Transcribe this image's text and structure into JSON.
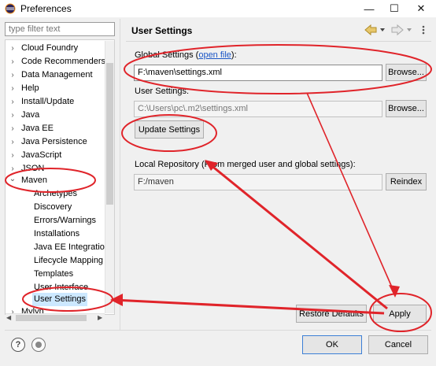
{
  "window": {
    "title": "Preferences",
    "minimize_glyph": "—",
    "maximize_glyph": "☐",
    "close_glyph": "✕",
    "icon": "eclipse-icon"
  },
  "filter": {
    "placeholder": "type filter text"
  },
  "tree": {
    "items": [
      {
        "label": "Cloud Foundry",
        "arrow": "›"
      },
      {
        "label": "Code Recommenders",
        "arrow": "›"
      },
      {
        "label": "Data Management",
        "arrow": "›"
      },
      {
        "label": "Help",
        "arrow": "›"
      },
      {
        "label": "Install/Update",
        "arrow": "›"
      },
      {
        "label": "Java",
        "arrow": "›"
      },
      {
        "label": "Java EE",
        "arrow": "›"
      },
      {
        "label": "Java Persistence",
        "arrow": "›"
      },
      {
        "label": "JavaScript",
        "arrow": "›"
      },
      {
        "label": "JSON",
        "arrow": "›"
      },
      {
        "label": "Maven",
        "arrow": "⌄"
      },
      {
        "label": "Archetypes"
      },
      {
        "label": "Discovery"
      },
      {
        "label": "Errors/Warnings"
      },
      {
        "label": "Installations"
      },
      {
        "label": "Java EE Integratio"
      },
      {
        "label": "Lifecycle Mapping"
      },
      {
        "label": "Templates"
      },
      {
        "label": "User Interface"
      },
      {
        "label": "User Settings"
      },
      {
        "label": "Mylyn",
        "arrow": "›"
      }
    ],
    "selected": "User Settings"
  },
  "page": {
    "title": "User Settings",
    "global_label": "Global Settings (",
    "global_link": "open file",
    "global_label_end": "):",
    "global_value": "F:\\maven\\settings.xml",
    "user_label": "User Settings:",
    "user_value": "C:\\Users\\pc\\.m2\\settings.xml",
    "browse1": "Browse...",
    "browse2": "Browse...",
    "update_button": "Update Settings",
    "local_repo_label": "Local Repository (From merged user and global settings):",
    "local_repo_value": "F:/maven",
    "reindex_button": "Reindex",
    "restore_button": "Restore Defaults",
    "apply_button": "Apply"
  },
  "footer": {
    "help_glyph": "?",
    "ok_button": "OK",
    "cancel_button": "Cancel"
  },
  "colors": {
    "annotation": "#e0242a",
    "selection": "#cce8ff",
    "link": "#1a55c6"
  }
}
